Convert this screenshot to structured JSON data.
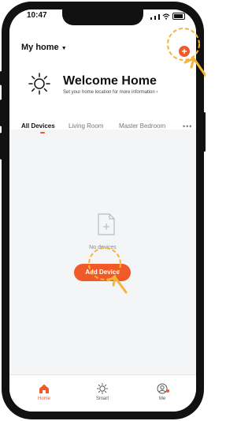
{
  "status_bar": {
    "time": "10:47"
  },
  "header": {
    "home_selector": "My home",
    "add_icon": "plus-icon"
  },
  "welcome": {
    "title": "Welcome Home",
    "subtitle": "Set your home location for more information"
  },
  "tabs": {
    "items": [
      {
        "label": "All Devices",
        "active": true
      },
      {
        "label": "Living Room",
        "active": false
      },
      {
        "label": "Master Bedroom",
        "active": false
      }
    ],
    "more_icon": "more-icon"
  },
  "empty_state": {
    "message": "No devices",
    "button": "Add Device"
  },
  "bottom_nav": {
    "items": [
      {
        "label": "Home",
        "icon": "home-icon",
        "active": true
      },
      {
        "label": "Smart",
        "icon": "sun-icon",
        "active": false
      },
      {
        "label": "Me",
        "icon": "user-icon",
        "active": false
      }
    ]
  },
  "colors": {
    "accent": "#f05a28",
    "background": "#f4f5f7"
  }
}
